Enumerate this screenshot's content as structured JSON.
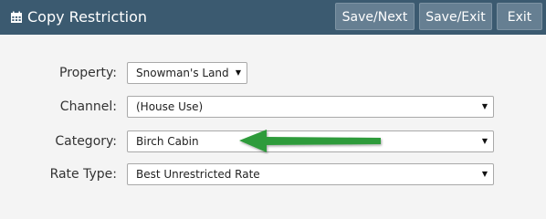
{
  "header": {
    "title": "Copy Restriction",
    "title_icon": "calendar-icon",
    "buttons": {
      "save_next": "Save/Next",
      "save_exit": "Save/Exit",
      "exit": "Exit"
    }
  },
  "form": {
    "property": {
      "label": "Property:",
      "value": "Snowman's Land"
    },
    "channel": {
      "label": "Channel:",
      "value": "(House Use)"
    },
    "category": {
      "label": "Category:",
      "value": "Birch Cabin"
    },
    "rate_type": {
      "label": "Rate Type:",
      "value": "Best Unrestricted Rate"
    }
  },
  "colors": {
    "header_bg": "#3b5a70",
    "button_bg": "#667f92",
    "annotation_arrow": "#2e9b3a"
  }
}
